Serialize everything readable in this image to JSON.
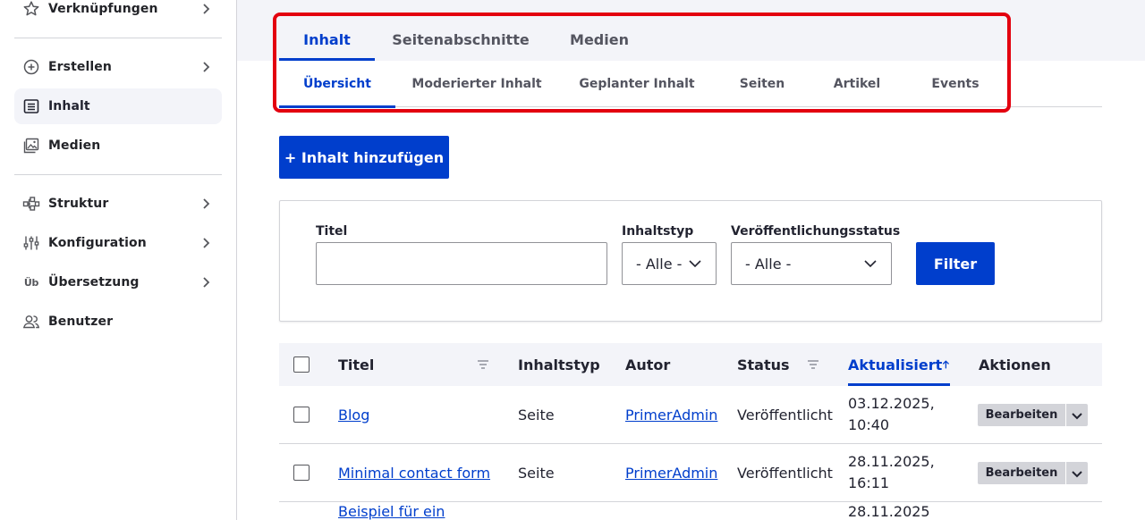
{
  "sidebar": {
    "items": [
      {
        "label": "Verknüpfungen",
        "icon": "star-icon",
        "has_children": true
      },
      {
        "label": "Erstellen",
        "icon": "plus-circle-icon",
        "has_children": true
      },
      {
        "label": "Inhalt",
        "icon": "content-list-icon",
        "has_children": false,
        "active": true
      },
      {
        "label": "Medien",
        "icon": "media-image-icon",
        "has_children": false
      },
      {
        "label": "Struktur",
        "icon": "structure-icon",
        "has_children": true
      },
      {
        "label": "Konfiguration",
        "icon": "sliders-icon",
        "has_children": true
      },
      {
        "label": "Übersetzung",
        "icon": "translation-icon",
        "icon_text": "Üb",
        "has_children": true
      },
      {
        "label": "Benutzer",
        "icon": "users-icon",
        "has_children": false
      }
    ]
  },
  "primary_tabs": [
    {
      "label": "Inhalt",
      "active": true
    },
    {
      "label": "Seitenabschnitte",
      "active": false
    },
    {
      "label": "Medien",
      "active": false
    }
  ],
  "secondary_tabs": [
    {
      "label": "Übersicht",
      "active": true
    },
    {
      "label": "Moderierter Inhalt",
      "active": false
    },
    {
      "label": "Geplanter Inhalt",
      "active": false
    },
    {
      "label": "Seiten",
      "active": false
    },
    {
      "label": "Artikel",
      "active": false
    },
    {
      "label": "Events",
      "active": false
    }
  ],
  "add_button_label": "+ Inhalt hinzufügen",
  "filters": {
    "title_label": "Titel",
    "title_value": "",
    "type_label": "Inhaltstyp",
    "type_value": "- Alle -",
    "status_label": "Veröffentlichungsstatus",
    "status_value": "- Alle -",
    "submit_label": "Filter"
  },
  "table": {
    "headers": {
      "title": "Titel",
      "type": "Inhaltstyp",
      "author": "Autor",
      "status": "Status",
      "updated": "Aktualisiert",
      "actions": "Aktionen"
    },
    "sorted_by": "Aktualisiert",
    "rows": [
      {
        "title": "Blog",
        "type": "Seite",
        "author": "PrimerAdmin",
        "status": "Veröffentlicht",
        "updated_date": "03.12.2025,",
        "updated_time": "10:40",
        "edit_label": "Bearbeiten"
      },
      {
        "title": "Minimal contact form",
        "type": "Seite",
        "author": "PrimerAdmin",
        "status": "Veröffentlicht",
        "updated_date": "28.11.2025,",
        "updated_time": "16:11",
        "edit_label": "Bearbeiten"
      },
      {
        "title": "Beispiel für ein",
        "type": "",
        "author": "",
        "status": "",
        "updated_date": "28.11.2025",
        "updated_time": "",
        "edit_label": ""
      }
    ]
  },
  "colors": {
    "accent": "#003ecc",
    "highlight": "#e3000f",
    "band": "#f3f4f9"
  }
}
